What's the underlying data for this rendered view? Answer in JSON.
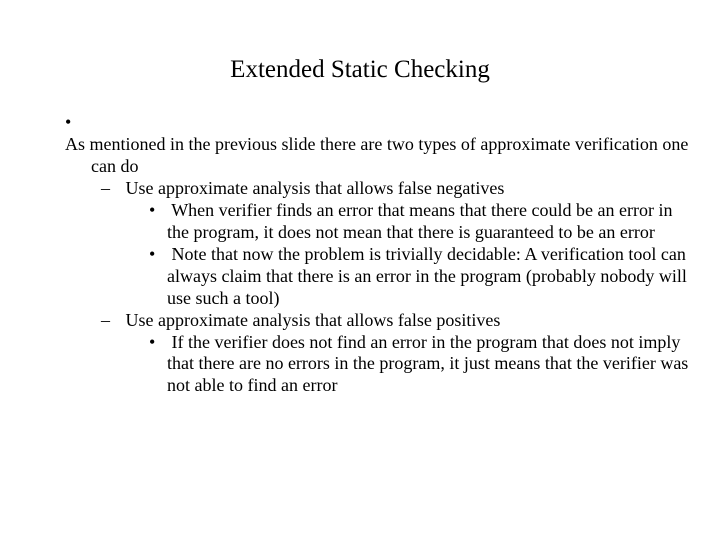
{
  "title": "Extended Static Checking",
  "bullets": {
    "main": "As mentioned  in the previous slide there are two types of approximate verification one can do",
    "sub1": {
      "heading": "Use approximate analysis that allows false negatives",
      "pt1": "When verifier finds an error that means that there could be an error in the program, it does not mean that there is guaranteed to be an error",
      "pt2": "Note that now the problem is trivially decidable: A verification tool can always claim that there is an error in the program (probably nobody will use such a tool)"
    },
    "sub2": {
      "heading": "Use approximate analysis that allows false positives",
      "pt1": "If  the verifier does not find an error in the program that does not imply that there are no errors in the program, it just means that the verifier was not able to find an error"
    }
  }
}
